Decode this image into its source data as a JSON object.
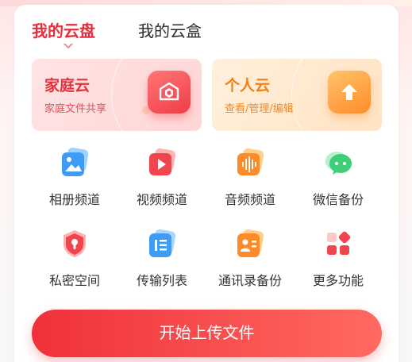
{
  "tabs": {
    "active_label": "我的云盘",
    "inactive_label": "我的云盒"
  },
  "features": {
    "family": {
      "title": "家庭云",
      "subtitle": "家庭文件共享",
      "icon": "home-box-icon"
    },
    "personal": {
      "title": "个人云",
      "subtitle": "查看/管理/编辑",
      "icon": "upload-arrow-icon"
    }
  },
  "grid": [
    {
      "label": "相册频道",
      "icon": "photo-album-icon"
    },
    {
      "label": "视频频道",
      "icon": "video-play-icon"
    },
    {
      "label": "音频频道",
      "icon": "audio-wave-icon"
    },
    {
      "label": "微信备份",
      "icon": "wechat-icon"
    },
    {
      "label": "私密空间",
      "icon": "privacy-shield-icon"
    },
    {
      "label": "传输列表",
      "icon": "transfer-list-icon"
    },
    {
      "label": "通讯录备份",
      "icon": "contacts-icon"
    },
    {
      "label": "更多功能",
      "icon": "more-grid-icon"
    }
  ],
  "upload_button": {
    "label": "开始上传文件"
  },
  "colors": {
    "accent_red": "#e62e3c",
    "accent_orange": "#ef8014",
    "text_dark": "#333333"
  }
}
